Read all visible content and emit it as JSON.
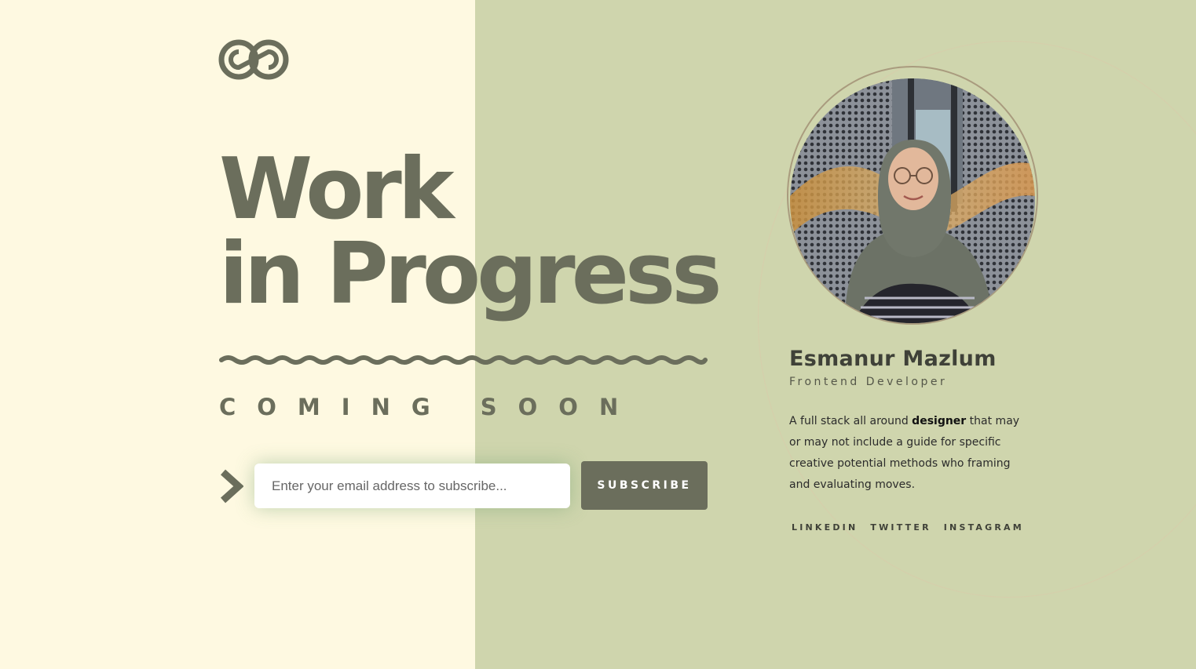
{
  "colors": {
    "left_background": "#fef9e1",
    "right_background": "#cfd5ad",
    "accent": "#6b6e5c",
    "button_text": "#ffffff"
  },
  "logo": {
    "icon": "infinity-loop-logo-icon"
  },
  "hero": {
    "headline_line1": "Work",
    "headline_line2": "in Progress",
    "divider_icon": "wavy-line-divider",
    "tagline": "COMING SOON"
  },
  "subscribe": {
    "arrow_icon": "chevron-right-icon",
    "email_placeholder": "Enter your email address to subscribe...",
    "email_value": "",
    "button_label": "SUBSCRIBE"
  },
  "profile": {
    "avatar_icon": "profile-photo",
    "name": "Esmanur Mazlum",
    "role": "Frontend Developer",
    "bio_before": "A full stack all around ",
    "bio_bold": "designer",
    "bio_after": " that may or may not include a guide for specific creative potential methods who framing and evaluating moves."
  },
  "social_links": [
    "LINKEDIN",
    "TWITTER",
    "INSTAGRAM"
  ]
}
